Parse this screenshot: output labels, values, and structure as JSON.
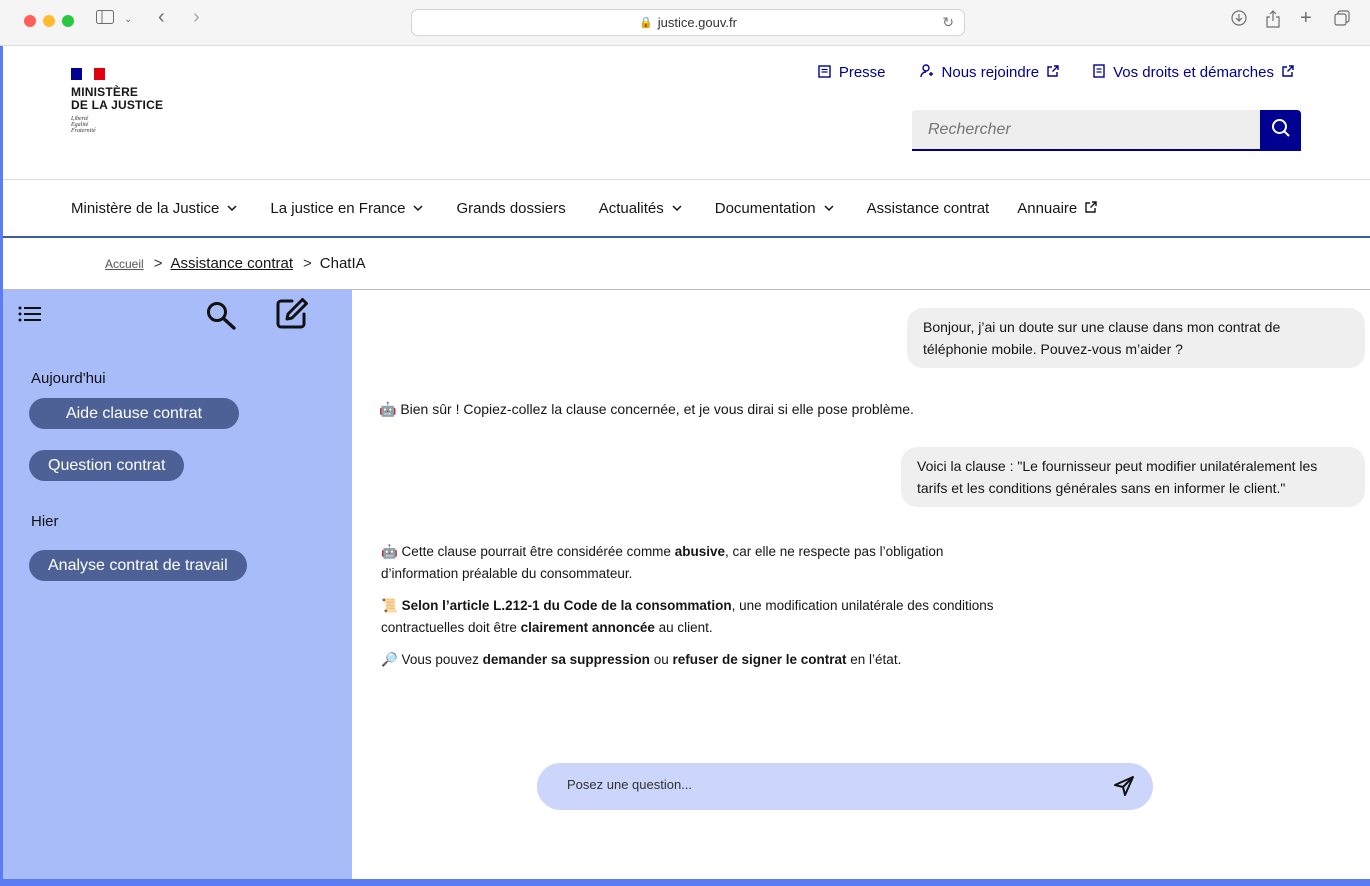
{
  "browser": {
    "url": "justice.gouv.fr"
  },
  "header": {
    "logo_line1": "MINISTÈRE",
    "logo_line2": "DE LA JUSTICE",
    "motto1": "Liberté",
    "motto2": "Égalité",
    "motto3": "Fraternité",
    "links": [
      {
        "label": "Presse",
        "icon": "newspaper-icon"
      },
      {
        "label": "Nous rejoindre",
        "icon": "user-icon"
      },
      {
        "label": "Vos droits et démarches",
        "icon": "document-icon"
      }
    ],
    "search_placeholder": "Rechercher"
  },
  "nav": {
    "items": [
      {
        "label": "Ministère de la Justice"
      },
      {
        "label": "La justice en France"
      },
      {
        "label": "Grands dossiers"
      },
      {
        "label": "Actualités"
      },
      {
        "label": "Documentation"
      },
      {
        "label": "Assistance contrat"
      },
      {
        "label": "Annuaire"
      }
    ]
  },
  "breadcrumb": {
    "home": "Accueil",
    "parent": "Assistance contrat",
    "current": "ChatIA"
  },
  "sidebar": {
    "today_label": "Aujourd'hui",
    "yesterday_label": "Hier",
    "conversations_today": [
      "Aide clause contrat",
      "Question contrat"
    ],
    "conversations_yesterday": [
      "Analyse contrat de travail"
    ]
  },
  "chat": {
    "user1_line1": "Bonjour, j’ai un doute sur une clause dans mon contrat de",
    "user1_line2": "téléphonie mobile. Pouvez-vous m’aider ?",
    "bot1": "🤖 Bien sûr ! Copiez-collez la clause concernée, et je vous dirai si elle pose problème.",
    "user2_line1": "Voici la clause : \"Le fournisseur peut modifier unilatéralement les",
    "user2_line2": "tarifs et les conditions générales sans en informer le client.\"",
    "bot2": {
      "p1_pre": "🤖 Cette clause pourrait être considérée comme ",
      "p1_bold": "abusive",
      "p1_post": ", car elle ne respecte pas l’obligation",
      "p1_line2": "d’information préalable du consommateur.",
      "p2_emoji": "📜 ",
      "p2_bold": "Selon l’article L.212-1 du Code de la consommation",
      "p2_post": ", une modification unilatérale des conditions",
      "p2_line2_pre": "contractuelles doit être ",
      "p2_line2_bold": "clairement annoncée",
      "p2_line2_post": " au client.",
      "p3_pre": "🔎 Vous pouvez ",
      "p3_bold1": "demander sa suppression",
      "p3_mid": " ou ",
      "p3_bold2": "refuser de signer le contrat",
      "p3_post": " en l’état."
    },
    "composer_placeholder": "Posez une question..."
  },
  "colors": {
    "brand_blue": "#000091",
    "sidebar_bg": "#a9bcfa",
    "pill_bg": "#4d6197",
    "composer_bg": "#ccd6fa"
  }
}
